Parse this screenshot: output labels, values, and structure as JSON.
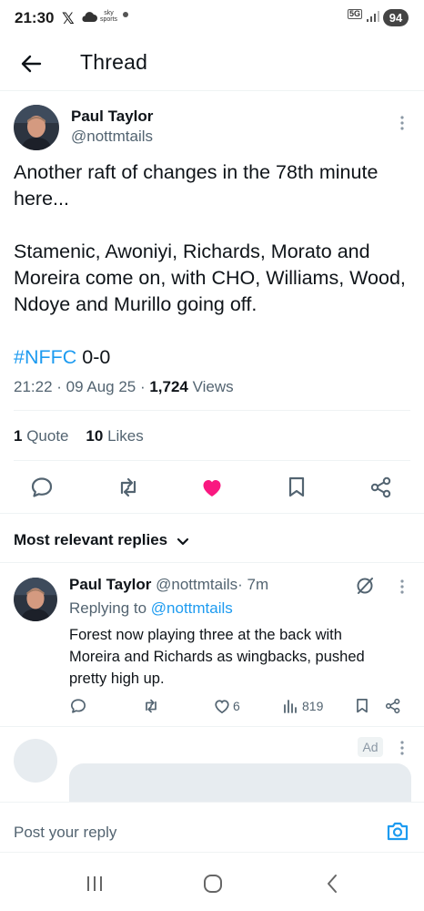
{
  "status_bar": {
    "time": "21:30",
    "x_glyph": "𝕏",
    "sky_line1": "sky",
    "sky_line2": "sports",
    "network": "5G",
    "battery": "94"
  },
  "header": {
    "title": "Thread",
    "back_icon": "arrow-left-icon"
  },
  "main_tweet": {
    "author_name": "Paul Taylor",
    "author_handle": "@nottmtails",
    "paragraph1": "Another raft of changes in the 78th minute here...",
    "paragraph2": "Stamenic, Awoniyi, Richards, Morato and Moreira come on, with CHO, Williams, Wood, Ndoye and Murillo going off.",
    "hashtag": "#NFFC",
    "score": " 0-0",
    "time": "21:22",
    "date": "09 Aug 25",
    "views_count": "1,724",
    "views_label": "Views",
    "quote_count": "1",
    "quote_label": "Quote",
    "likes_count": "10",
    "likes_label": "Likes",
    "liked": true
  },
  "replies_section": {
    "filter_label": "Most relevant replies"
  },
  "reply": {
    "author_name": "Paul Taylor",
    "author_handle": "@nottmtails",
    "time_ago": "· 7m",
    "replying_prefix": "Replying to ",
    "replying_to": "@nottmtails",
    "text": "Forest now playing three at the back with Moreira and Richards as wingbacks, pushed pretty high up.",
    "like_count": "6",
    "view_count": "819"
  },
  "ad": {
    "badge": "Ad"
  },
  "compose": {
    "placeholder": "Post your reply"
  },
  "colors": {
    "accent": "#1d9bf0",
    "like": "#f91880",
    "text_secondary": "#536471"
  }
}
